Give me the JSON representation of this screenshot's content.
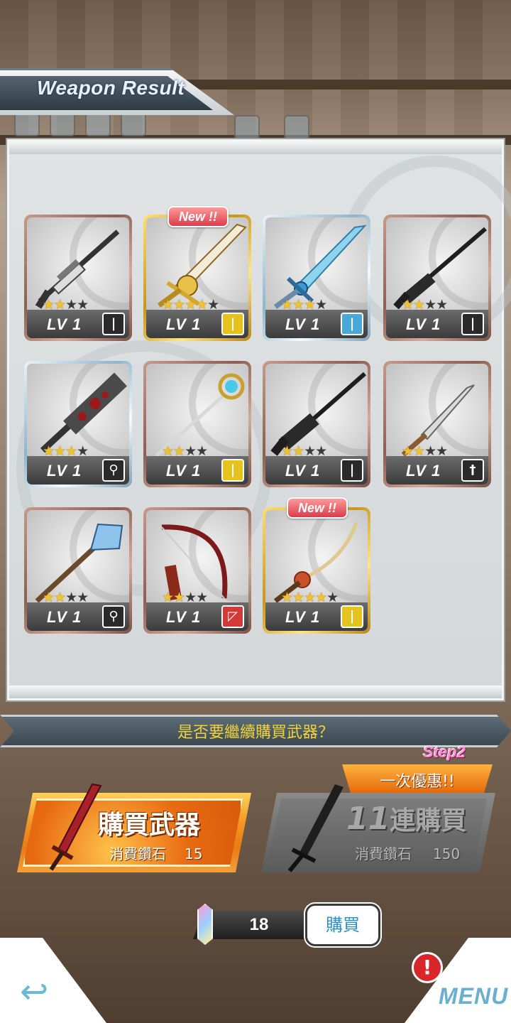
{
  "header": {
    "title": "Weapon Result"
  },
  "weapons": [
    {
      "level": "LV 1",
      "stars_on": "★★",
      "stars_off": "★★",
      "type_glyph": "|",
      "type_icon": "rifle-type-icon",
      "rarity_color": "#8d5f52",
      "is_new": false,
      "new_label": ""
    },
    {
      "level": "LV 1",
      "stars_on": "★★★★",
      "stars_off": "★",
      "type_glyph": "|",
      "type_icon": "sword-type-icon",
      "rarity_color": "#c9961b",
      "is_new": true,
      "new_label": "New !!"
    },
    {
      "level": "LV 1",
      "stars_on": "★★★",
      "stars_off": "★",
      "type_glyph": "|",
      "type_icon": "sword-type-icon",
      "rarity_color": "#8fb5cc",
      "is_new": false,
      "new_label": ""
    },
    {
      "level": "LV 1",
      "stars_on": "★★",
      "stars_off": "★★",
      "type_glyph": "|",
      "type_icon": "rifle-type-icon",
      "rarity_color": "#8d5f52",
      "is_new": false,
      "new_label": ""
    },
    {
      "level": "LV 1",
      "stars_on": "★★★",
      "stars_off": "★",
      "type_glyph": "⚲",
      "type_icon": "mace-type-icon",
      "rarity_color": "#8fb5cc",
      "is_new": false,
      "new_label": ""
    },
    {
      "level": "LV 1",
      "stars_on": "★★",
      "stars_off": "★★",
      "type_glyph": "|",
      "type_icon": "staff-type-icon",
      "rarity_color": "#8d5f52",
      "is_new": false,
      "new_label": ""
    },
    {
      "level": "LV 1",
      "stars_on": "★★",
      "stars_off": "★★",
      "type_glyph": "|",
      "type_icon": "rifle-type-icon",
      "rarity_color": "#8d5f52",
      "is_new": false,
      "new_label": ""
    },
    {
      "level": "LV 1",
      "stars_on": "★★",
      "stars_off": "★★",
      "type_glyph": "†",
      "type_icon": "dagger-type-icon",
      "rarity_color": "#8d5f52",
      "is_new": false,
      "new_label": ""
    },
    {
      "level": "LV 1",
      "stars_on": "★★",
      "stars_off": "★★",
      "type_glyph": "⚲",
      "type_icon": "mace-type-icon",
      "rarity_color": "#8d5f52",
      "is_new": false,
      "new_label": ""
    },
    {
      "level": "LV 1",
      "stars_on": "★★",
      "stars_off": "★★",
      "type_glyph": "◸",
      "type_icon": "bow-type-icon",
      "rarity_color": "#8d5f52",
      "is_new": false,
      "new_label": ""
    },
    {
      "level": "LV 1",
      "stars_on": "★★★★",
      "stars_off": "★",
      "type_glyph": "|",
      "type_icon": "katana-type-icon",
      "rarity_color": "#c9961b",
      "is_new": true,
      "new_label": "New !!"
    }
  ],
  "prompt": {
    "question": "是否要繼續購買武器？"
  },
  "single_buy": {
    "title": "購買武器",
    "cost_label": "消費鑽石",
    "cost_value": "15"
  },
  "multi_buy": {
    "count": "11",
    "title_suffix": "連購買",
    "cost_label": "消費鑽石",
    "cost_value": "150",
    "promo": "一次優惠!!",
    "step_tag": "Step2"
  },
  "wallet": {
    "diamonds": "18",
    "buy_label": "購買"
  },
  "nav": {
    "menu_label": "MENU",
    "alert_glyph": "!"
  },
  "colors": {
    "accent_orange": "#ea7b14",
    "accent_cyan": "#6aaed0",
    "prompt_yellow": "#f1d23a",
    "new_red": "#d83c4a"
  }
}
